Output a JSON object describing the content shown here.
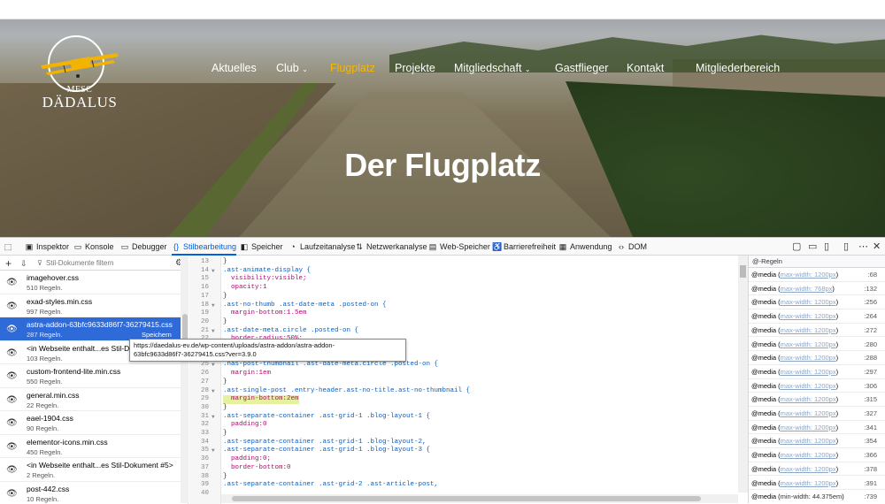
{
  "site": {
    "logo_sub": "MFSC",
    "logo_main": "DÄDALUS",
    "nav": [
      {
        "label": "Aktuelles",
        "active": false,
        "dropdown": false
      },
      {
        "label": "Club",
        "active": false,
        "dropdown": true
      },
      {
        "label": "Flugplatz",
        "active": true,
        "dropdown": false
      },
      {
        "label": "Projekte",
        "active": false,
        "dropdown": false
      },
      {
        "label": "Mitgliedschaft",
        "active": false,
        "dropdown": true
      },
      {
        "label": "Gastflieger",
        "active": false,
        "dropdown": false
      },
      {
        "label": "Kontakt",
        "active": false,
        "dropdown": false
      },
      {
        "label": "Mitgliederbereich",
        "active": false,
        "dropdown": false
      }
    ],
    "hero_title": "Der Flugplatz",
    "accent_color": "#f5b800"
  },
  "devtools": {
    "tabs": [
      {
        "icon": "inspector-icon",
        "label": "Inspektor"
      },
      {
        "icon": "console-icon",
        "label": "Konsole"
      },
      {
        "icon": "debugger-icon",
        "label": "Debugger"
      },
      {
        "icon": "style-editor-icon",
        "label": "Stilbearbeitung"
      },
      {
        "icon": "storage-icon",
        "label": "Speicher"
      },
      {
        "icon": "performance-icon",
        "label": "Laufzeitanalyse"
      },
      {
        "icon": "network-icon",
        "label": "Netzwerkanalyse"
      },
      {
        "icon": "web-storage-icon",
        "label": "Web-Speicher"
      },
      {
        "icon": "accessibility-icon",
        "label": "Barrierefreiheit"
      },
      {
        "icon": "application-icon",
        "label": "Anwendung"
      },
      {
        "icon": "dom-icon",
        "label": "DOM"
      }
    ],
    "active_tab": "Stilbearbeitung",
    "filter_placeholder": "Stil-Dokumente filtern",
    "sheets": [
      {
        "name": "imagehover.css",
        "rules": "510 Regeln.",
        "selected": false
      },
      {
        "name": "exad-styles.min.css",
        "rules": "997 Regeln.",
        "selected": false
      },
      {
        "name": "astra-addon-63bfc9633d86f7-36279415.css",
        "rules": "287 Regeln.",
        "selected": true,
        "save": "Speichern"
      },
      {
        "name": "<in Webseite enthalt...es Stil-Da",
        "rules": "103 Regeln.",
        "selected": false
      },
      {
        "name": "custom-frontend-lite.min.css",
        "rules": "550 Regeln.",
        "selected": false
      },
      {
        "name": "general.min.css",
        "rules": "22 Regeln.",
        "selected": false
      },
      {
        "name": "eael-1904.css",
        "rules": "90 Regeln.",
        "selected": false
      },
      {
        "name": "elementor-icons.min.css",
        "rules": "450 Regeln.",
        "selected": false
      },
      {
        "name": "<in Webseite enthalt...es Stil-Dokument #5>",
        "rules": "2 Regeln.",
        "selected": false
      },
      {
        "name": "post-442.css",
        "rules": "10 Regeln.",
        "selected": false
      }
    ],
    "tooltip": [
      "https://daedalus-ev.de/wp-content/uploads/astra-addon/astra-addon-",
      "63bfc9633d86f7-36279415.css?ver=3.9.0"
    ],
    "code": [
      {
        "n": "13",
        "f": false,
        "t": "}",
        "k": "p"
      },
      {
        "n": "14",
        "f": true,
        "t": ".ast-animate-display {",
        "k": "s"
      },
      {
        "n": "15",
        "f": false,
        "t": "  visibility:visible;",
        "k": "d"
      },
      {
        "n": "16",
        "f": false,
        "t": "  opacity:1",
        "k": "d"
      },
      {
        "n": "17",
        "f": false,
        "t": "}",
        "k": "p"
      },
      {
        "n": "18",
        "f": true,
        "t": ".ast-no-thumb .ast-date-meta .posted-on {",
        "k": "s"
      },
      {
        "n": "19",
        "f": false,
        "t": "  margin-bottom:1.5em",
        "k": "d"
      },
      {
        "n": "20",
        "f": false,
        "t": "}",
        "k": "p"
      },
      {
        "n": "21",
        "f": true,
        "t": ".ast-date-meta.circle .posted-on {",
        "k": "s"
      },
      {
        "n": "22",
        "f": false,
        "t": "  border-radius:50%;",
        "k": "d"
      },
      {
        "n": "23",
        "f": false,
        "t": "  overflow:hidden;",
        "k": "d"
      },
      {
        "n": "24",
        "f": false,
        "t": "}",
        "k": "p"
      },
      {
        "n": "25",
        "f": true,
        "t": ".has-post-thumbnail .ast-date-meta.circle .posted-on {",
        "k": "s"
      },
      {
        "n": "26",
        "f": false,
        "t": "  margin:1em",
        "k": "d"
      },
      {
        "n": "27",
        "f": false,
        "t": "}",
        "k": "p"
      },
      {
        "n": "28",
        "f": true,
        "t": ".ast-single-post .entry-header.ast-no-title.ast-no-thumbnail {",
        "k": "s"
      },
      {
        "n": "29",
        "f": false,
        "t": "  margin-bottom:2em",
        "k": "h"
      },
      {
        "n": "30",
        "f": false,
        "t": "}",
        "k": "p"
      },
      {
        "n": "31",
        "f": true,
        "t": ".ast-separate-container .ast-grid-1 .blog-layout-1 {",
        "k": "s"
      },
      {
        "n": "32",
        "f": false,
        "t": "  padding:0",
        "k": "d"
      },
      {
        "n": "33",
        "f": false,
        "t": "}",
        "k": "p"
      },
      {
        "n": "34",
        "f": false,
        "t": ".ast-separate-container .ast-grid-1 .blog-layout-2,",
        "k": "s"
      },
      {
        "n": "35",
        "f": true,
        "t": ".ast-separate-container .ast-grid-1 .blog-layout-3 {",
        "k": "s"
      },
      {
        "n": "36",
        "f": false,
        "t": "  padding:0;",
        "k": "d"
      },
      {
        "n": "37",
        "f": false,
        "t": "  border-bottom:0",
        "k": "d"
      },
      {
        "n": "38",
        "f": false,
        "t": "}",
        "k": "p"
      },
      {
        "n": "39",
        "f": false,
        "t": ".ast-separate-container .ast-grid-2 .ast-article-post,",
        "k": "s"
      },
      {
        "n": "40",
        "f": false,
        "t": "",
        "k": "p"
      }
    ],
    "at_rules_header": "@-Regeln",
    "media": [
      {
        "q": "max-width: 1200px",
        "line": ":68",
        "plain": false
      },
      {
        "q": "max-width: 768px",
        "line": ":132",
        "plain": false
      },
      {
        "q": "max-width: 1200px",
        "line": ":256",
        "plain": false
      },
      {
        "q": "max-width: 1200px",
        "line": ":264",
        "plain": false
      },
      {
        "q": "max-width: 1200px",
        "line": ":272",
        "plain": false
      },
      {
        "q": "max-width: 1200px",
        "line": ":280",
        "plain": false
      },
      {
        "q": "max-width: 1200px",
        "line": ":288",
        "plain": false
      },
      {
        "q": "max-width: 1200px",
        "line": ":297",
        "plain": false
      },
      {
        "q": "max-width: 1200px",
        "line": ":306",
        "plain": false
      },
      {
        "q": "max-width: 1200px",
        "line": ":315",
        "plain": false
      },
      {
        "q": "max-width: 1200px",
        "line": ":327",
        "plain": false
      },
      {
        "q": "max-width: 1200px",
        "line": ":341",
        "plain": false
      },
      {
        "q": "max-width: 1200px",
        "line": ":354",
        "plain": false
      },
      {
        "q": "max-width: 1200px",
        "line": ":366",
        "plain": false
      },
      {
        "q": "max-width: 1200px",
        "line": ":378",
        "plain": false
      },
      {
        "q": "max-width: 1200px",
        "line": ":391",
        "plain": false
      },
      {
        "q": "min-width: 44.375em",
        "line": ":739",
        "plain": true
      }
    ],
    "media_prefix": "@media"
  }
}
